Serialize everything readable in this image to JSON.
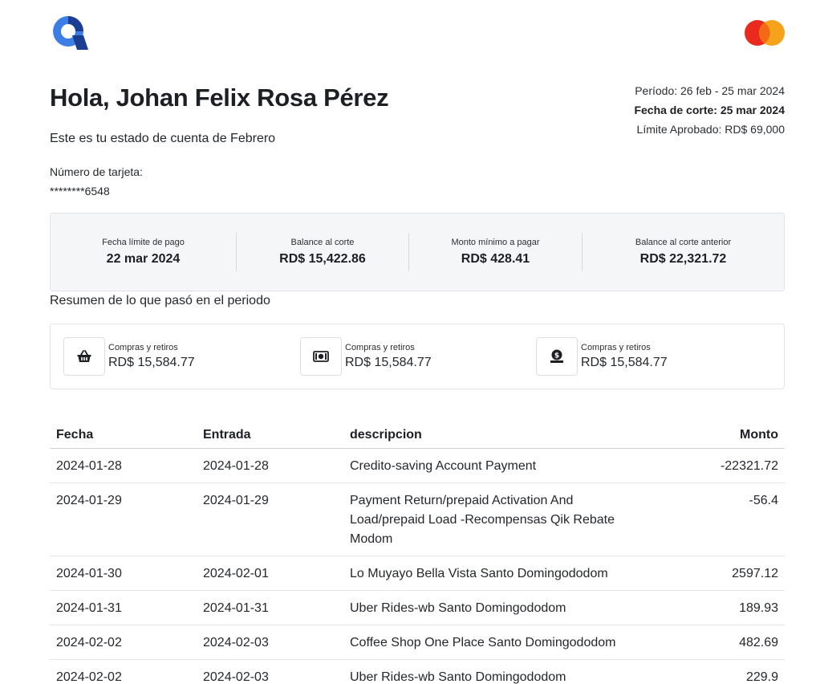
{
  "header": {
    "logo_icon": "qik-logo-icon",
    "card_brand_icon": "mastercard-icon"
  },
  "greeting": "Hola, Johan Felix Rosa Pérez",
  "subtitle": "Este es tu estado de cuenta de Febrero",
  "card": {
    "label": "Número de tarjeta:",
    "number": "********6548"
  },
  "period": {
    "period_text": "Período: 26 feb - 25 mar 2024",
    "cutoff_text": "Fecha de corte: 25 mar 2024",
    "limit_text": "Límite Aprobado: RD$ 69,000"
  },
  "summary": [
    {
      "label": "Fecha límite de pago",
      "value": "22 mar 2024"
    },
    {
      "label": "Balance al corte",
      "value": "RD$ 15,422.86"
    },
    {
      "label": "Monto mínimo a pagar",
      "value": "RD$ 428.41"
    },
    {
      "label": "Balance al corte anterior",
      "value": "RD$ 22,321.72"
    }
  ],
  "resumen_title": "Resumen de lo que pasó en el periodo",
  "movements": [
    {
      "icon": "shopping-basket-icon",
      "label": "Compras y retiros",
      "amount": "RD$ 15,584.77"
    },
    {
      "icon": "cash-icon",
      "label": "Compras y retiros",
      "amount": "RD$ 15,584.77"
    },
    {
      "icon": "money-bag-icon",
      "label": "Compras y retiros",
      "amount": "RD$ 15,584.77"
    }
  ],
  "table": {
    "headers": [
      "Fecha",
      "Entrada",
      "descripcion",
      "Monto"
    ],
    "rows": [
      [
        "2024-01-28",
        "2024-01-28",
        "Credito-saving Account Payment",
        "-22321.72"
      ],
      [
        "2024-01-29",
        "2024-01-29",
        "Payment Return/prepaid Activation And Load/prepaid Load -Recompensas Qik Rebate Modom",
        "-56.4"
      ],
      [
        "2024-01-30",
        "2024-02-01",
        "Lo Muyayo Bella Vista Santo Domingododom",
        "2597.12"
      ],
      [
        "2024-01-31",
        "2024-01-31",
        "Uber Rides-wb Santo Domingododom",
        "189.93"
      ],
      [
        "2024-02-02",
        "2024-02-03",
        "Coffee Shop One Place Santo Domingododom",
        "482.69"
      ],
      [
        "2024-02-02",
        "2024-02-03",
        "Uber Rides-wb Santo Domingododom",
        "229.9"
      ]
    ]
  }
}
